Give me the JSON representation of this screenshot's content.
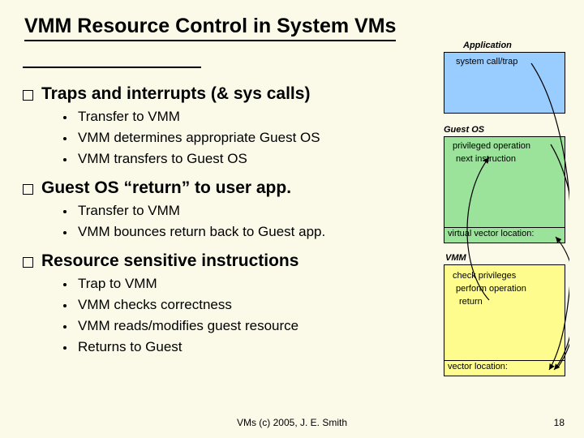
{
  "title": "VMM Resource Control in System VMs",
  "bullets": [
    {
      "text": "Traps and interrupts (& sys calls)",
      "subs": [
        "Transfer to VMM",
        "VMM determines appropriate Guest OS",
        "VMM transfers to Guest OS"
      ]
    },
    {
      "text": "Guest OS “return” to user app.",
      "subs": [
        "Transfer to VMM",
        "VMM bounces return back to Guest app."
      ]
    },
    {
      "text": "Resource sensitive instructions",
      "subs": [
        "Trap to VMM",
        "VMM checks correctness",
        "VMM reads/modifies guest resource",
        "Returns to Guest"
      ]
    }
  ],
  "diagram": {
    "app_label": "Application",
    "app_line": "system call/trap",
    "guest_label": "Guest OS",
    "guest_priv": "privileged operation",
    "guest_next": "next instruction",
    "guest_vvl": "virtual vector location:",
    "vmm_label": "VMM",
    "vmm_chk": "check  privileges",
    "vmm_perf": "perform operation",
    "vmm_ret": "return",
    "vmm_vl": "vector location:"
  },
  "footer": "VMs (c) 2005, J. E. Smith",
  "page": "18"
}
